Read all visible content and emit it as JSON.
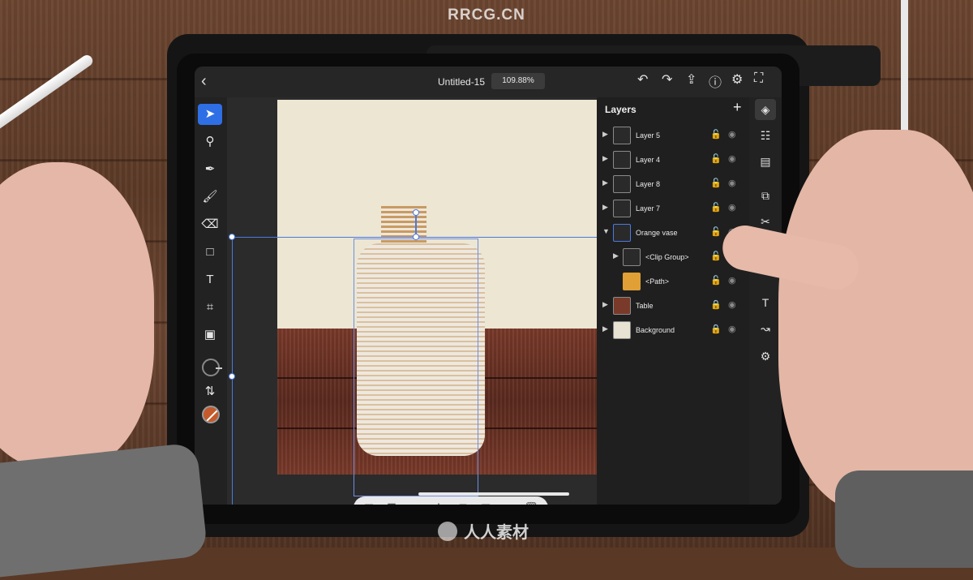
{
  "watermarks": {
    "top": "RRCG.CN",
    "bottom": "人人素材"
  },
  "topbar": {
    "back_icon": "chevron-left-icon",
    "doc_title": "Untitled-15",
    "zoom": "109.88%",
    "icons": [
      "undo-icon",
      "redo-icon",
      "share-icon",
      "help-icon",
      "settings-icon",
      "workspace-icon"
    ]
  },
  "tools": [
    "select-icon",
    "direct-select-icon",
    "pen-icon",
    "brush-icon",
    "eraser-icon",
    "rectangle-icon",
    "text-icon",
    "crop-icon",
    "image-icon"
  ],
  "fill_color": "#c45a2c",
  "accent_color": "#2f6fe6",
  "layers_panel": {
    "title": "Layers",
    "layers": [
      {
        "name": "Layer 5",
        "locked": false
      },
      {
        "name": "Layer 4",
        "locked": false
      },
      {
        "name": "Layer 8",
        "locked": false
      },
      {
        "name": "Layer 7",
        "locked": false
      },
      {
        "name": "Orange vase",
        "locked": false,
        "expanded": true,
        "selected": true
      },
      {
        "name": "<Clip Group>",
        "locked": false,
        "indent": 1
      },
      {
        "name": "<Path>",
        "locked": false,
        "indent": 1
      },
      {
        "name": "Table",
        "locked": true
      },
      {
        "name": "Background",
        "locked": true
      }
    ]
  },
  "right_rail": [
    "layers-icon",
    "properties-icon",
    "align-icon",
    "arrange-icon",
    "scissors-icon",
    "type-icon",
    "path-icon",
    "gear-icon"
  ],
  "action_bar": [
    "fill-icon",
    "stroke-icon",
    "stack-icon",
    "move-icon",
    "lock-icon",
    "group-icon",
    "duplicate-icon",
    "delete-icon"
  ]
}
